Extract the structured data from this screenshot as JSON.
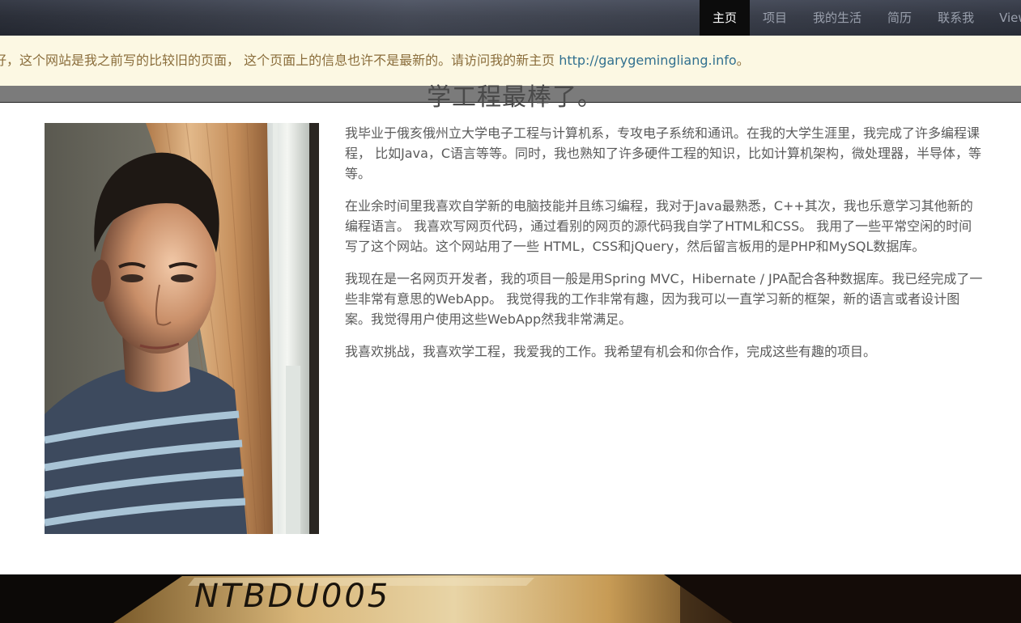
{
  "nav": {
    "items": [
      {
        "label": "主页",
        "active": true
      },
      {
        "label": "项目",
        "active": false
      },
      {
        "label": "我的生活",
        "active": false
      },
      {
        "label": "简历",
        "active": false
      },
      {
        "label": "联系我",
        "active": false
      },
      {
        "label": "View",
        "active": false
      }
    ]
  },
  "notice": {
    "text": "好，这个网站是我之前写的比较旧的页面， 这个页面上的信息也许不是最新的。请访问我的新主页 ",
    "link_text": "http://garygemingliang.info",
    "suffix": "。"
  },
  "page": {
    "title": "学工程最棒了。"
  },
  "content": {
    "paragraphs": [
      "我毕业于俄亥俄州立大学电子工程与计算机系，专攻电子系统和通讯。在我的大学生涯里，我完成了许多编程课程， 比如Java，C语言等等。同时，我也熟知了许多硬件工程的知识，比如计算机架构，微处理器，半导体，等等。",
      "在业余时间里我喜欢自学新的电脑技能并且练习编程，我对于Java最熟悉，C++其次，我也乐意学习其他新的编程语言。 我喜欢写网页代码，通过看别的网页的源代码我自学了HTML和CSS。 我用了一些平常空闲的时间写了这个网站。这个网站用了一些 HTML，CSS和jQuery，然后留言板用的是PHP和MySQL数据库。",
      "我现在是一名网页开发者，我的项目一般是用Spring MVC，Hibernate / JPA配合各种数据库。我已经完成了一些非常有意思的WebApp。 我觉得我的工作非常有趣，因为我可以一直学习新的框架，新的语言或者设计图案。我觉得用户使用这些WebApp然我非常满足。",
      "我喜欢挑战，我喜欢学工程，我爱我的工作。我希望有机会和你合作，完成这些有趣的项目。"
    ]
  },
  "bottom_image": {
    "label_text": "NTBDU005"
  },
  "colors": {
    "nav_active_bg": "#0c0c0c",
    "notice_bg": "#fcf8e3",
    "notice_text": "#8a6d3b",
    "link": "#31708f"
  }
}
